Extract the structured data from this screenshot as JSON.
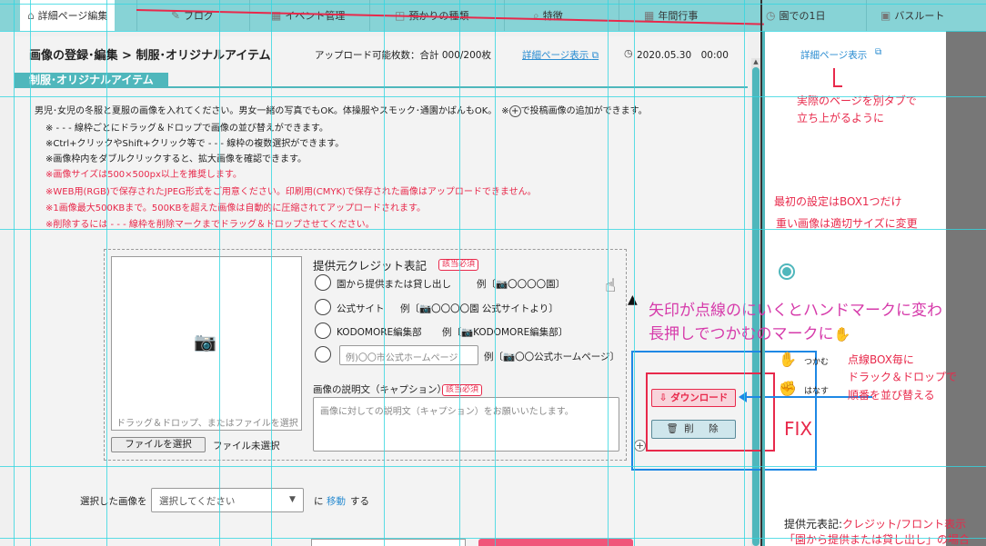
{
  "nav": {
    "items": [
      {
        "label": "詳細ページ編集",
        "icon": "home-icon"
      },
      {
        "label": "ブログ",
        "icon": "pencil-icon"
      },
      {
        "label": "イベント管理",
        "icon": "calendar-icon"
      },
      {
        "label": "預かりの種類",
        "icon": "bag-icon"
      },
      {
        "label": "特徴",
        "icon": "search-icon"
      },
      {
        "label": "年間行事",
        "icon": "calendar-icon"
      },
      {
        "label": "園での1日",
        "icon": "clock-icon"
      },
      {
        "label": "バスルート",
        "icon": "bus-icon"
      }
    ]
  },
  "header": {
    "title": "画像の登録･編集 > 制服･オリジナルアイテム",
    "upload_count": "アップロード可能枚数：合計 000/200枚",
    "detail_link": "詳細ページ表示",
    "date": "2020.05.30　00:00"
  },
  "section": {
    "title": "制服･オリジナルアイテム"
  },
  "instructions": {
    "line1": "男児･女児の冬服と夏服の画像を入れてください。男女一緒の写真でもOK。体操服やスモック･通園かばんもOK。　※",
    "line1_tail": "で投稿画像の追加ができます。",
    "line2": "※ - - - 線枠ごとにドラッグ＆ドロップで画像の並び替えができます。",
    "line3": "※Ctrl+クリックやShift+クリック等で - - - 線枠の複数選択ができます。",
    "line4": "※画像枠内をダブルクリックすると、拡大画像を確認できます。",
    "red1": "※画像サイズは500×500px以上を推奨します。",
    "red2": "※WEB用(RGB)で保存されたJPEG形式をご用意ください。印刷用(CMYK)で保存された画像はアップロードできません。",
    "red3": "※1画像最大500KBまで。500KBを超えた画像は自動的に圧縮されてアップロードされます。",
    "red4": "※削除するには - - - 線枠を削除マークまでドラッグ＆ドロップさせてください。"
  },
  "upload": {
    "drop_hint": "ドラッグ＆ドロップ、またはファイルを選択",
    "file_button": "ファイルを選択",
    "file_status": "ファイル未選択",
    "credit_title": "提供元クレジット表記",
    "required": "該当必須",
    "options": [
      {
        "label": "園から提供または貸し出し",
        "example": "例〔📷〇〇〇〇園〕"
      },
      {
        "label": "公式サイト",
        "example": "例〔📷〇〇〇〇園 公式サイトより〕"
      },
      {
        "label": "KODOMORE編集部",
        "example": "例〔📷KODOMORE編集部〕"
      }
    ],
    "custom_placeholder": "例)〇〇市公式ホームページ",
    "custom_example": "例〔📷〇〇公式ホームページ〕",
    "caption_title": "画像の説明文（キャプション）",
    "caption_placeholder": "画像に対しての説明文（キャプション）をお願いいたします。"
  },
  "actions": {
    "download": "ダウンロード",
    "delete": "削　除",
    "fix": "FIX"
  },
  "hands": {
    "grab": "つかむ",
    "release": "はなす"
  },
  "bottom": {
    "selected_label": "選択した画像を",
    "select_placeholder": "選択してください",
    "ni": "に",
    "move": "移動",
    "suru": "する"
  },
  "annotations": {
    "side_link": "詳細ページ表示",
    "new_tab_1": "実際のページを別タブで",
    "new_tab_2": "立ち上がるように",
    "box1": "最初の設定はBOX1つだけ",
    "resize": "重い画像は適切サイズに変更",
    "hover_1": "矢印が点線のにいくとハンドマークに変わ",
    "hover_2": "長押しでつかむのマークに",
    "reorder_1": "点線BOX毎に",
    "reorder_2": "ドラック＆ドロップで",
    "reorder_3": "順番を並び替える",
    "credit_key": "提供元表記:",
    "credit_val": "クレジット/フロント表示",
    "credit_2": "「園から提供または貸し出し」の場合"
  }
}
